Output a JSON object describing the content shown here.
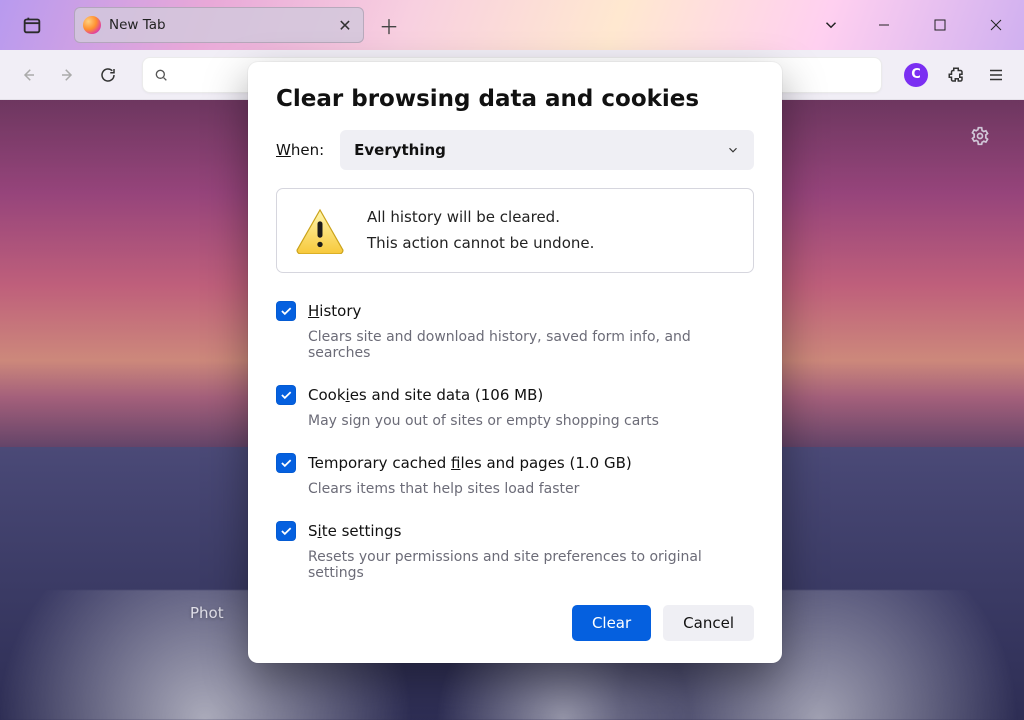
{
  "titlebar": {
    "tab_title": "New Tab"
  },
  "toolbar": {
    "account_initial": "C"
  },
  "page": {
    "photo_caption_prefix": "Phot"
  },
  "dialog": {
    "title": "Clear browsing data and cookies",
    "when_label": "When:",
    "when_value": "Everything",
    "warning_line1": "All history will be cleared.",
    "warning_line2": "This action cannot be undone.",
    "options": [
      {
        "label_pre": "",
        "label_u": "H",
        "label_post": "istory",
        "desc": "Clears site and download history, saved form info, and searches",
        "checked": true
      },
      {
        "label_pre": "Cook",
        "label_u": "i",
        "label_post": "es and site data (106 MB)",
        "desc": "May sign you out of sites or empty shopping carts",
        "checked": true
      },
      {
        "label_pre": "Temporary cached ",
        "label_u": "f",
        "label_post": "iles and pages (1.0 GB)",
        "desc": "Clears items that help sites load faster",
        "checked": true
      },
      {
        "label_pre": "S",
        "label_u": "i",
        "label_post": "te settings",
        "desc": "Resets your permissions and site preferences to original settings",
        "checked": true
      }
    ],
    "clear_label": "Clear",
    "cancel_label": "Cancel"
  }
}
